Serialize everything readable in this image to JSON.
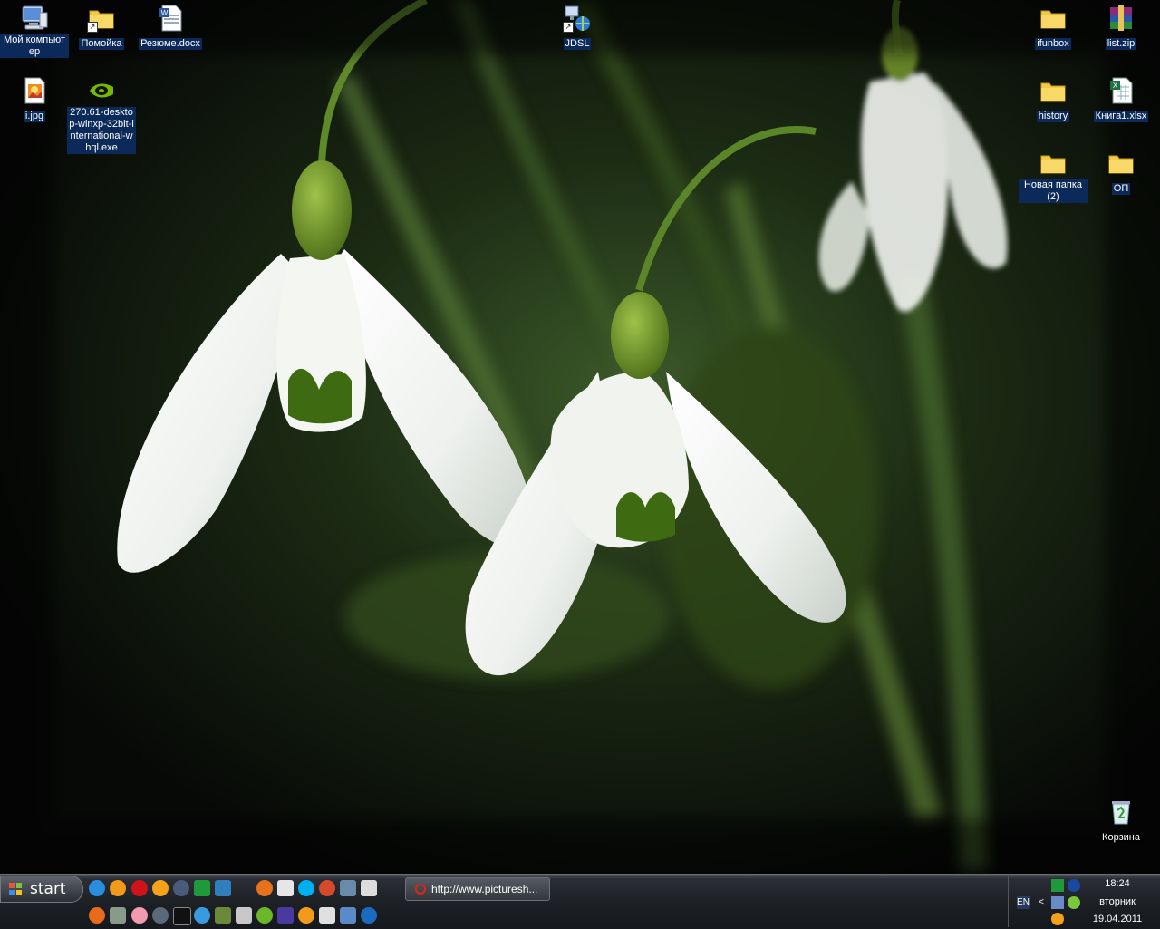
{
  "desktop": {
    "icons": [
      {
        "id": "my-computer",
        "label": "Мой компьютер",
        "icon": "computer-icon"
      },
      {
        "id": "pomoika",
        "label": "Помойка",
        "icon": "folder-shortcut-icon"
      },
      {
        "id": "resume",
        "label": "Резюме.docx",
        "icon": "word-document-icon"
      },
      {
        "id": "jdsl",
        "label": "JDSL",
        "icon": "network-connection-icon"
      },
      {
        "id": "ifunbox",
        "label": "ifunbox",
        "icon": "folder-icon"
      },
      {
        "id": "listzip",
        "label": "list.zip",
        "icon": "winrar-archive-icon"
      },
      {
        "id": "ijpg",
        "label": "i.jpg",
        "icon": "image-file-icon"
      },
      {
        "id": "nvidia",
        "label": "270.61-desktop-winxp-32bit-international-whql.exe",
        "icon": "nvidia-installer-icon"
      },
      {
        "id": "history",
        "label": "history",
        "icon": "folder-icon"
      },
      {
        "id": "kniga",
        "label": "Книга1.xlsx",
        "icon": "excel-document-icon"
      },
      {
        "id": "novaya",
        "label": "Новая папка (2)",
        "icon": "folder-icon"
      },
      {
        "id": "op",
        "label": "ОП",
        "icon": "folder-icon"
      },
      {
        "id": "korzina",
        "label": "Корзина",
        "icon": "recycle-bin-icon"
      }
    ]
  },
  "taskbar": {
    "start_label": "start",
    "quick_launch": [
      "ie-icon",
      "chrome-icon",
      "opera-icon",
      "avast-icon",
      "pidgin-icon",
      "icq-icon",
      "qip-icon",
      "firefox-icon",
      "utorrent-icon",
      "skype-icon",
      "miranda-icon",
      "upload-icon",
      "notepad-icon",
      "alarm-icon",
      "tools-icon",
      "pink-ball-icon",
      "steam-icon",
      "terminal-icon",
      "itunes-icon",
      "minecraft-icon",
      "cube-icon",
      "green-ball-icon",
      "scribe-icon",
      "ring-icon",
      "cursor-icon",
      "picasa-icon",
      "hp-icon"
    ],
    "task_button_label": "http://www.picturesh...",
    "tray": {
      "language": "EN",
      "icons": [
        "icq-tray-icon",
        "network-tray-icon",
        "speaker-tray-icon",
        "flower-tray-icon",
        "ubuntu-tray-icon"
      ]
    },
    "clock": {
      "time": "18:24",
      "day": "вторник",
      "date": "19.04.2011"
    }
  },
  "colors": {
    "label_selected_bg": "#0b2a5a",
    "taskbar": "#1c1f24",
    "task_icon": "#e2231a"
  }
}
